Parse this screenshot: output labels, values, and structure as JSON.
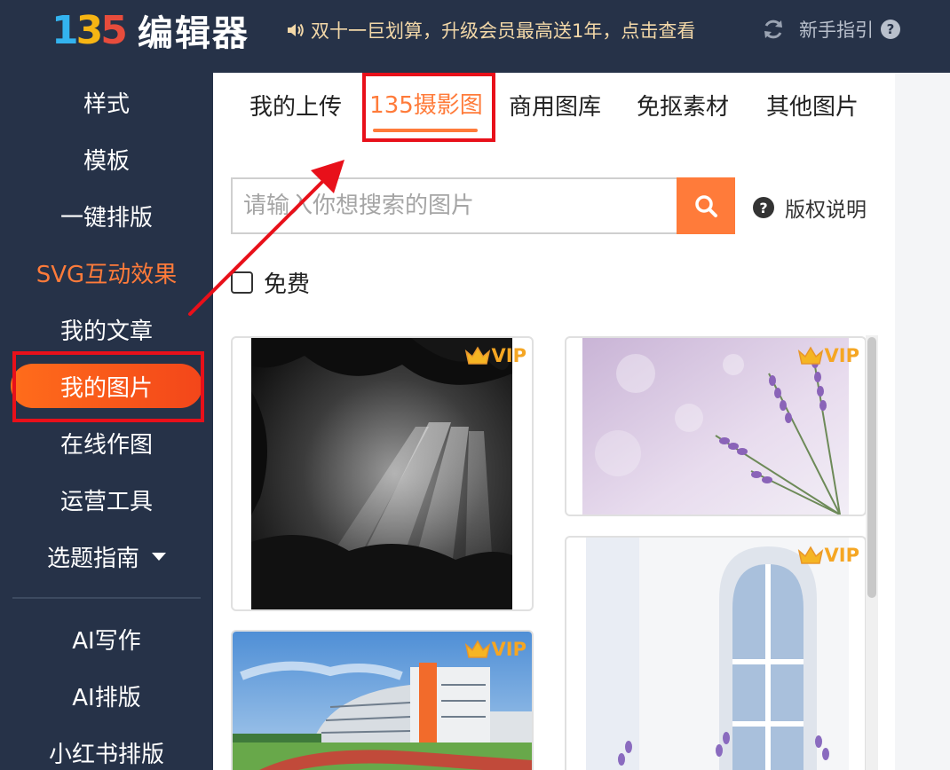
{
  "app": {
    "logo_digits": [
      "1",
      "3",
      "5"
    ],
    "logo_name": "编辑器",
    "notice": "双十一巨划算，升级会员最高送1年，点击查看",
    "guide_label": "新手指引",
    "help_glyph": "?"
  },
  "sidebar": {
    "items": [
      {
        "label": "样式"
      },
      {
        "label": "模板"
      },
      {
        "label": "一键排版"
      },
      {
        "label": "SVG互动效果"
      },
      {
        "label": "我的文章"
      },
      {
        "label": "我的图片"
      },
      {
        "label": "在线作图"
      },
      {
        "label": "运营工具"
      },
      {
        "label": "选题指南"
      },
      {
        "label": "AI写作"
      },
      {
        "label": "AI排版"
      },
      {
        "label": "小红书排版"
      }
    ]
  },
  "tabs": [
    {
      "label": "我的上传"
    },
    {
      "label": "135摄影图"
    },
    {
      "label": "商用图库"
    },
    {
      "label": "免抠素材"
    },
    {
      "label": "其他图片"
    }
  ],
  "search": {
    "placeholder": "请输入你想搜索的图片",
    "copyright_label": "版权说明",
    "copyright_glyph": "?"
  },
  "filter": {
    "free_label": "免费",
    "free_checked": false
  },
  "images": [
    {
      "badge": "VIP",
      "subject": "sun rays through trees, black and white"
    },
    {
      "badge": "VIP",
      "subject": "lavender flowers on purple bokeh"
    },
    {
      "badge": "VIP",
      "subject": "white arched window with lavender"
    },
    {
      "badge": "VIP",
      "subject": "school building with running track"
    }
  ],
  "colors": {
    "sidebar_bg": "#263248",
    "accent": "#ff7b3a",
    "active_gradient_start": "#ff6d1b",
    "active_gradient_end": "#f3461a",
    "vip": "#f5a623",
    "highlight_box": "#e8101a",
    "notice_text": "#f3d8a8"
  }
}
